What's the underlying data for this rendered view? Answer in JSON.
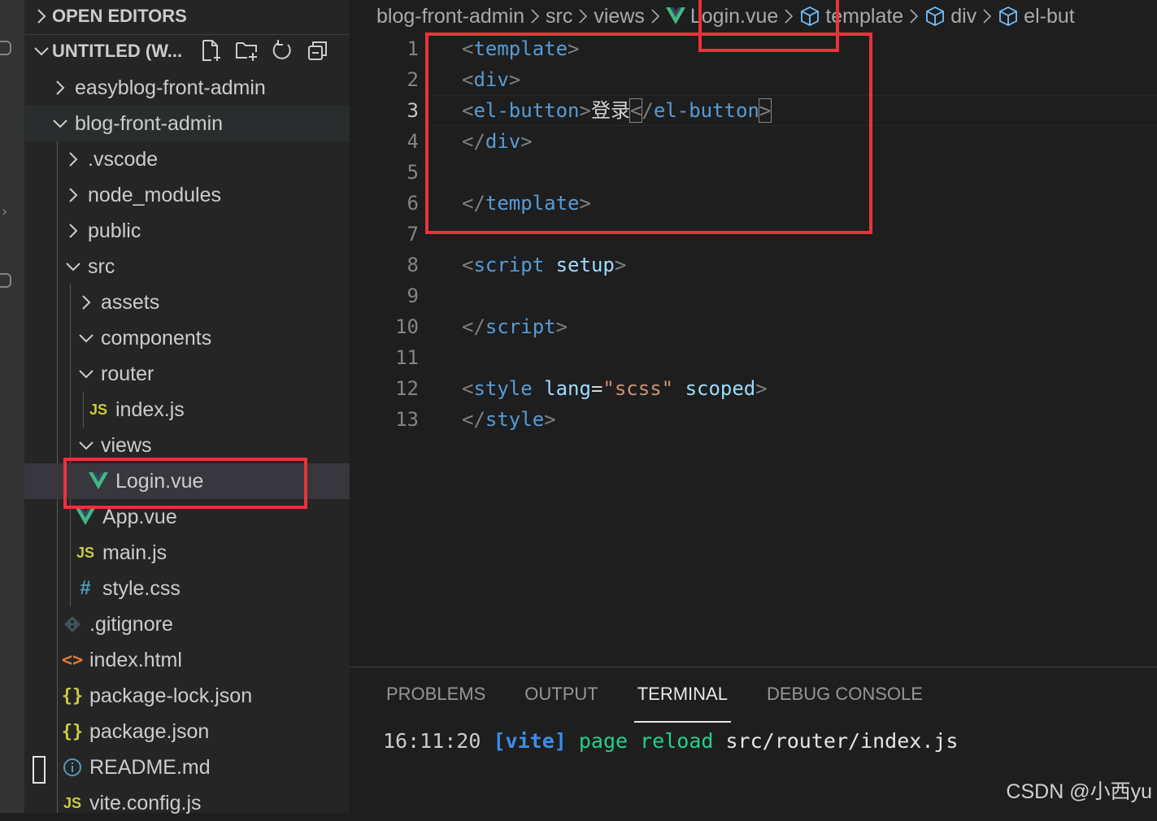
{
  "sidebar": {
    "open_editors_label": "OPEN EDITORS",
    "workspace_label": "UNTITLED (W...",
    "actions": [
      "new-file-icon",
      "new-folder-icon",
      "refresh-icon",
      "collapse-all-icon"
    ],
    "tree": [
      {
        "label": "easyblog-front-admin",
        "kind": "folder-closed"
      },
      {
        "label": "blog-front-admin",
        "kind": "folder-open"
      },
      {
        "label": ".vscode",
        "kind": "folder-closed"
      },
      {
        "label": "node_modules",
        "kind": "folder-closed"
      },
      {
        "label": "public",
        "kind": "folder-closed"
      },
      {
        "label": "src",
        "kind": "folder-open"
      },
      {
        "label": "assets",
        "kind": "folder-closed"
      },
      {
        "label": "components",
        "kind": "folder-open"
      },
      {
        "label": "router",
        "kind": "folder-open"
      },
      {
        "label": "index.js",
        "kind": "js",
        "icon_text": "JS"
      },
      {
        "label": "views",
        "kind": "folder-open"
      },
      {
        "label": "Login.vue",
        "kind": "vue"
      },
      {
        "label": "App.vue",
        "kind": "vue"
      },
      {
        "label": "main.js",
        "kind": "js",
        "icon_text": "JS"
      },
      {
        "label": "style.css",
        "kind": "css",
        "icon_text": "#"
      },
      {
        "label": ".gitignore",
        "kind": "git"
      },
      {
        "label": "index.html",
        "kind": "html",
        "icon_text": "<>"
      },
      {
        "label": "package-lock.json",
        "kind": "json",
        "icon_text": "{}"
      },
      {
        "label": "package.json",
        "kind": "json",
        "icon_text": "{}"
      },
      {
        "label": "README.md",
        "kind": "info"
      },
      {
        "label": "vite.config.js",
        "kind": "js",
        "icon_text": "JS"
      }
    ]
  },
  "breadcrumb": [
    "blog-front-admin",
    "src",
    "views",
    "Login.vue",
    "template",
    "div",
    "el-but"
  ],
  "editor": {
    "line_numbers": [
      "1",
      "2",
      "3",
      "4",
      "5",
      "6",
      "7",
      "8",
      "9",
      "10",
      "11",
      "12",
      "13"
    ],
    "active_line": "3",
    "tokens": {
      "l1": {
        "open": "<",
        "tag": "template",
        "close": ">"
      },
      "l2": {
        "open": "<",
        "tag": "div",
        "close": ">"
      },
      "l3": {
        "open": "<",
        "tag": "el-button",
        "close": ">",
        "text": "登录",
        "close_open": "<",
        "close_slash": "/",
        "close_tag": "el-button",
        "close_end": ">"
      },
      "l4": {
        "open": "</",
        "tag": "div",
        "close": ">"
      },
      "l6": {
        "open": "</",
        "tag": "template",
        "close": ">"
      },
      "l8": {
        "open": "<",
        "tag": "script",
        "attr": "setup",
        "close": ">"
      },
      "l10": {
        "open": "</",
        "tag": "script",
        "close": ">"
      },
      "l12": {
        "open": "<",
        "tag": "style",
        "attr1": "lang",
        "eq": "=",
        "val": "\"scss\"",
        "attr2": "scoped",
        "close": ">"
      },
      "l13": {
        "open": "</",
        "tag": "style",
        "close": ">"
      }
    }
  },
  "panel": {
    "tabs": [
      "PROBLEMS",
      "OUTPUT",
      "TERMINAL",
      "DEBUG CONSOLE"
    ],
    "active_tab": "TERMINAL",
    "terminal": {
      "time": "16:11:20",
      "tag": "[vite]",
      "msg": "page reload",
      "path": "src/router/index.js"
    }
  },
  "watermark": "CSDN @小西yu",
  "colors": {
    "highlight_box": "#e8333b",
    "vue_green": "#41b883",
    "tag_blue": "#569cd6"
  }
}
